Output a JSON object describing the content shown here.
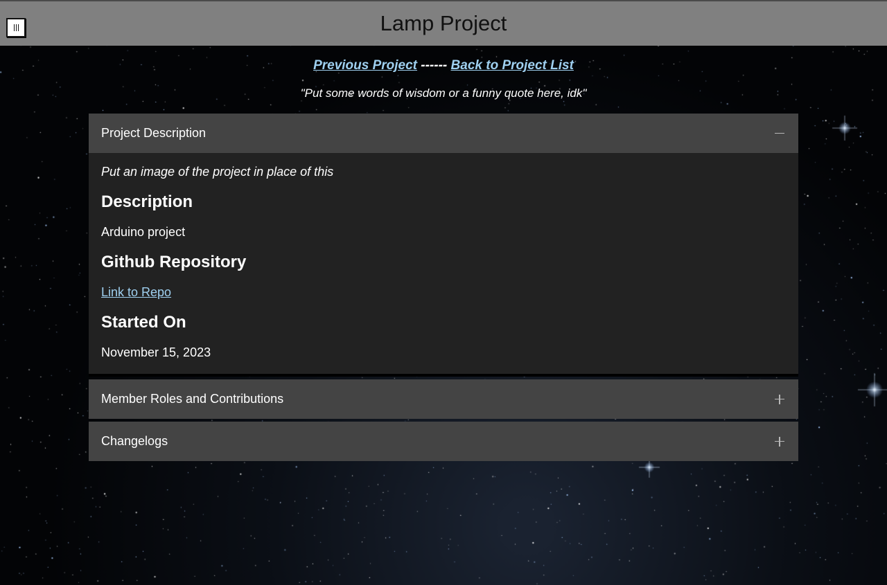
{
  "header": {
    "title": "Lamp Project",
    "menu_icon": "menu-icon"
  },
  "nav": {
    "previous_label": "Previous Project",
    "separator": "------",
    "back_label": "Back to Project List"
  },
  "quote": "\"Put some words of wisdom or a funny quote here, idk\"",
  "sections": [
    {
      "title": "Project Description",
      "expanded": true,
      "toggle_icon": "minus-icon",
      "content": {
        "image_placeholder": "Put an image of the project in place of this",
        "description_heading": "Description",
        "description_text": "Arduino project",
        "repo_heading": "Github Repository",
        "repo_link_label": "Link to Repo",
        "started_heading": "Started On",
        "started_date": "November 15, 2023"
      }
    },
    {
      "title": "Member Roles and Contributions",
      "expanded": false,
      "toggle_icon": "plus-icon"
    },
    {
      "title": "Changelogs",
      "expanded": false,
      "toggle_icon": "plus-icon"
    }
  ],
  "colors": {
    "header_bg": "#808080",
    "accordion_header_bg": "#444444",
    "accordion_body_bg": "#222222",
    "link": "#9fd0f0",
    "page_bg": "#050608"
  }
}
